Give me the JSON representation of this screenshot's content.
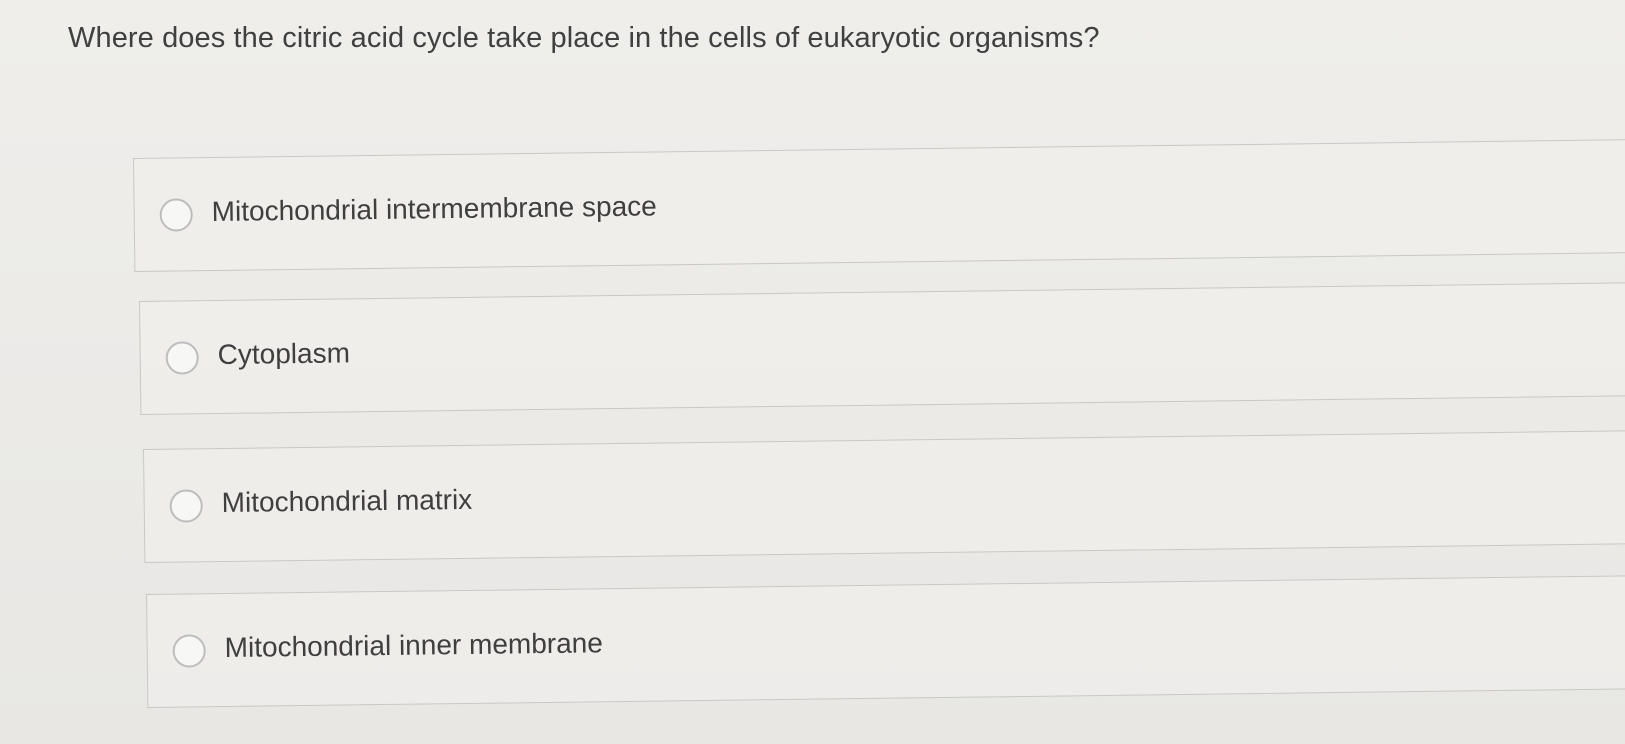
{
  "question": {
    "text": "Where does the citric acid cycle take place in the cells of eukaryotic organisms?"
  },
  "options": [
    {
      "label": "Mitochondrial intermembrane space",
      "selected": false
    },
    {
      "label": "Cytoplasm",
      "selected": false
    },
    {
      "label": "Mitochondrial matrix",
      "selected": false
    },
    {
      "label": "Mitochondrial inner membrane",
      "selected": false
    }
  ]
}
